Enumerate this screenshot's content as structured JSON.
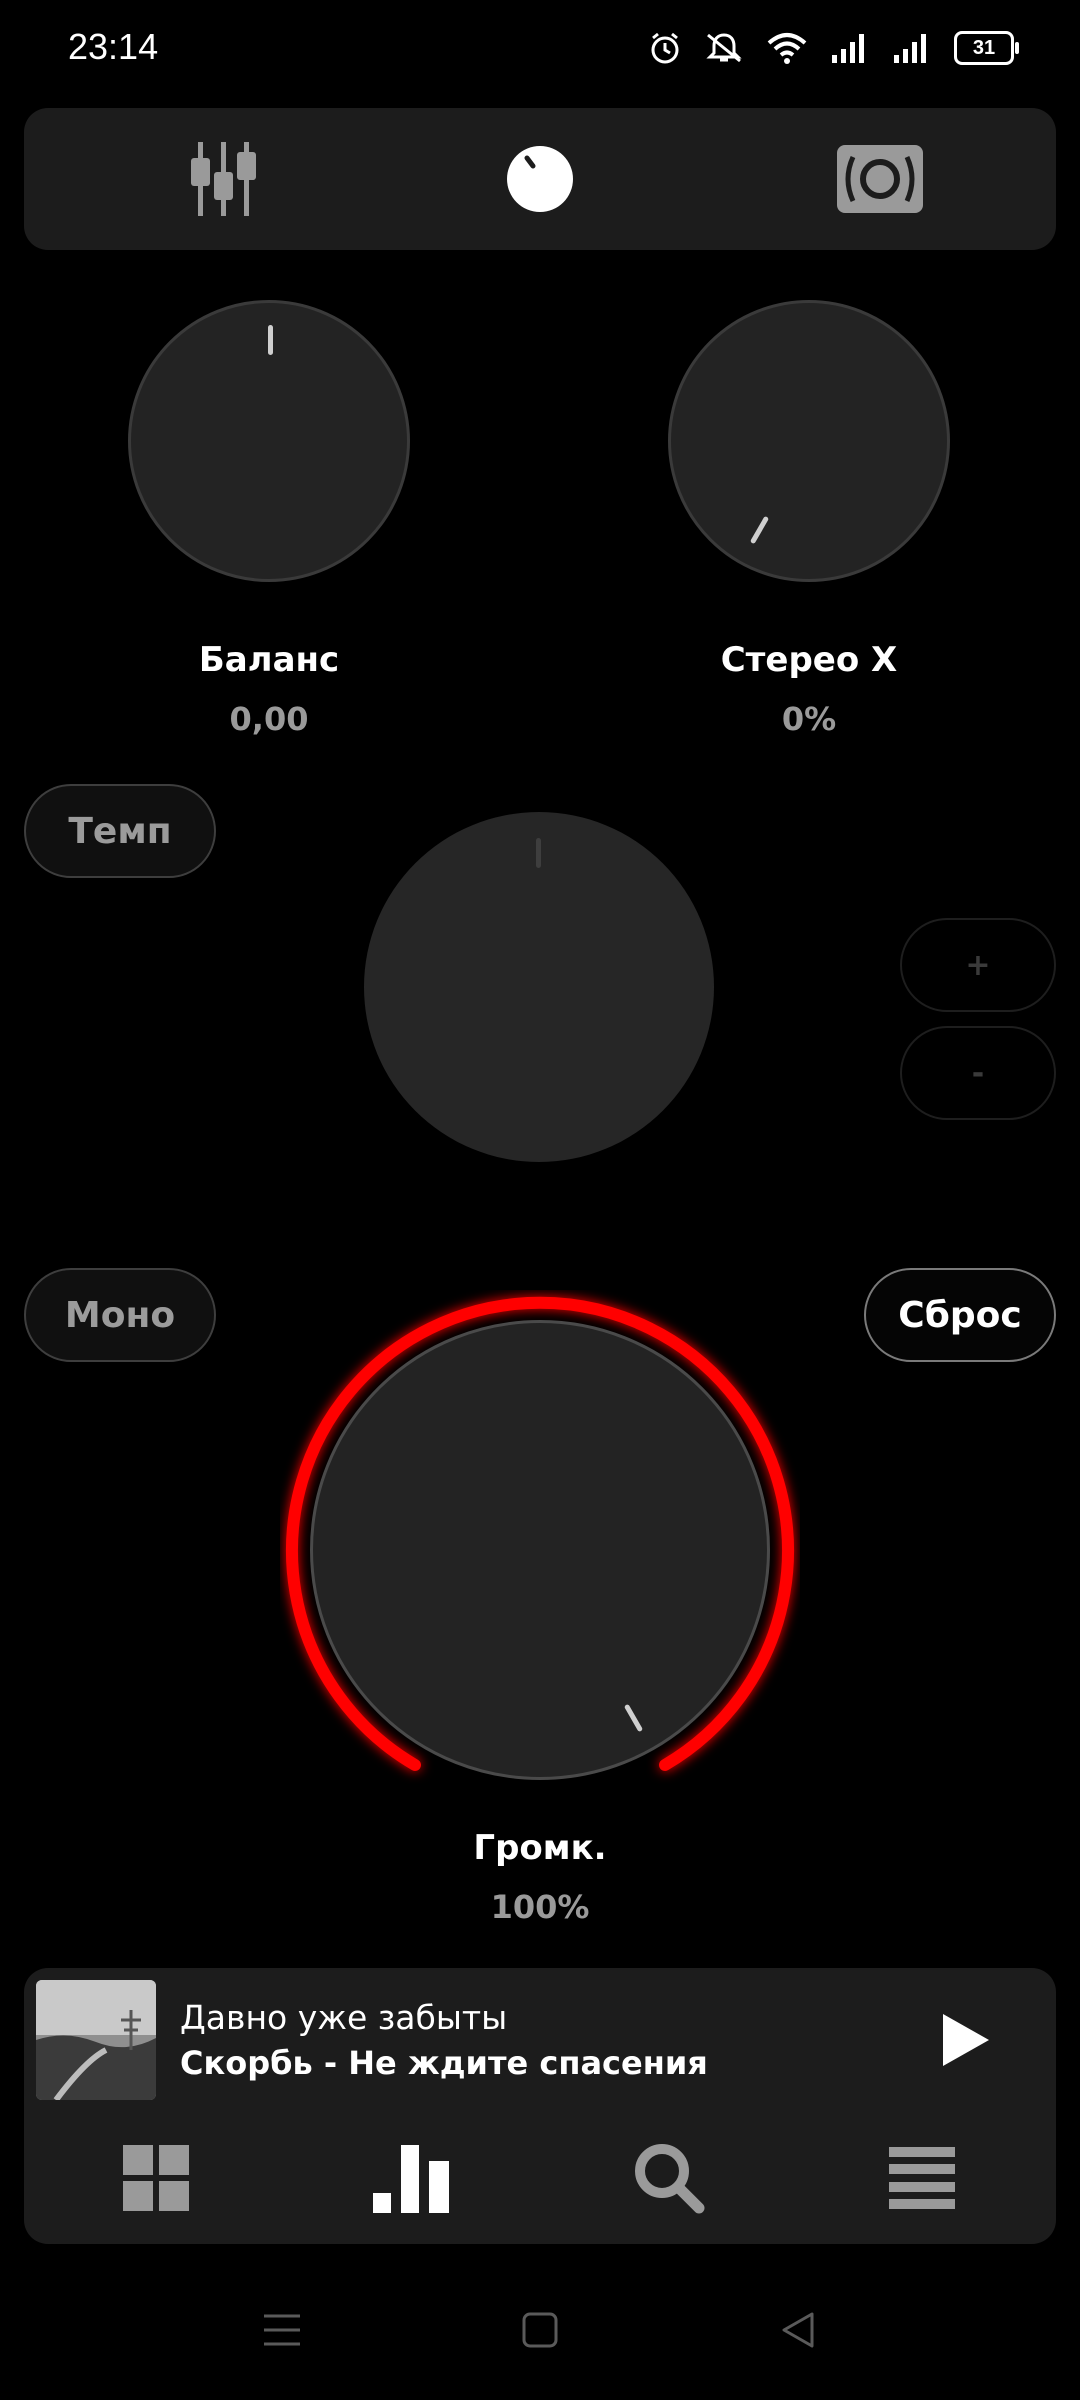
{
  "status": {
    "time": "23:14",
    "battery": "31",
    "icons": [
      "alarm-icon",
      "mute-icon",
      "wifi-icon",
      "signal-icon",
      "signal-icon",
      "battery-icon"
    ]
  },
  "topbar": {
    "tabs": [
      {
        "icon": "equalizer-sliders-icon"
      },
      {
        "icon": "knob-icon"
      },
      {
        "icon": "speaker-icon"
      }
    ]
  },
  "knobs": {
    "balance": {
      "label": "Баланс",
      "value": "0,00"
    },
    "stereo": {
      "label": "Стерео X",
      "value": "0%"
    },
    "volume": {
      "label": "Громк.",
      "value": "100%"
    }
  },
  "buttons": {
    "tempo": "Темп",
    "plus": "+",
    "minus": "-",
    "mono": "Моно",
    "reset": "Сброс"
  },
  "player": {
    "title": "Давно уже забыты",
    "artist_track": "Скорбь - Не ждите спасения",
    "play_icon": "play-icon"
  },
  "bottom_nav": [
    "grid-icon",
    "chart-icon",
    "search-icon",
    "list-icon"
  ],
  "system_nav": [
    "menu-icon",
    "home-icon",
    "back-icon"
  ],
  "colors": {
    "accent": "#ff0000",
    "background": "#000000",
    "panel": "#1c1c1c",
    "knob": "#232323"
  }
}
